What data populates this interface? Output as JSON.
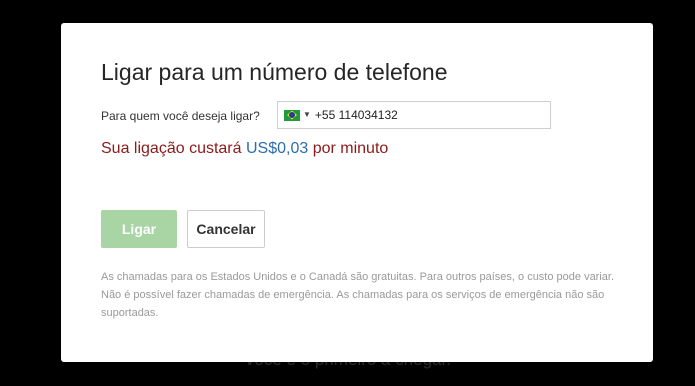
{
  "backdrop": {
    "text": "Você é o primeiro a chegar."
  },
  "dialog": {
    "title": "Ligar para um número de telefone",
    "question_label": "Para quem você deseja ligar?",
    "phone": {
      "country_flag": "brazil-flag-icon",
      "value": "+55 114034132"
    },
    "cost": {
      "prefix": "Sua ligação custará",
      "price": "US$0,03",
      "suffix": "por minuto"
    },
    "buttons": {
      "call_label": "Ligar",
      "cancel_label": "Cancelar"
    },
    "disclaimer": "As chamadas para os Estados Unidos e o Canadá são gratuitas. Para outros países, o custo pode variar. Não é possível fazer chamadas de emergência. As chamadas para os serviços de emergência não são suportadas."
  },
  "colors": {
    "background": "#000000",
    "dialog": "#ffffff",
    "cost_text": "#8b1a1a",
    "price_text": "#2c6db0",
    "call_button": "#a8d5a3"
  }
}
